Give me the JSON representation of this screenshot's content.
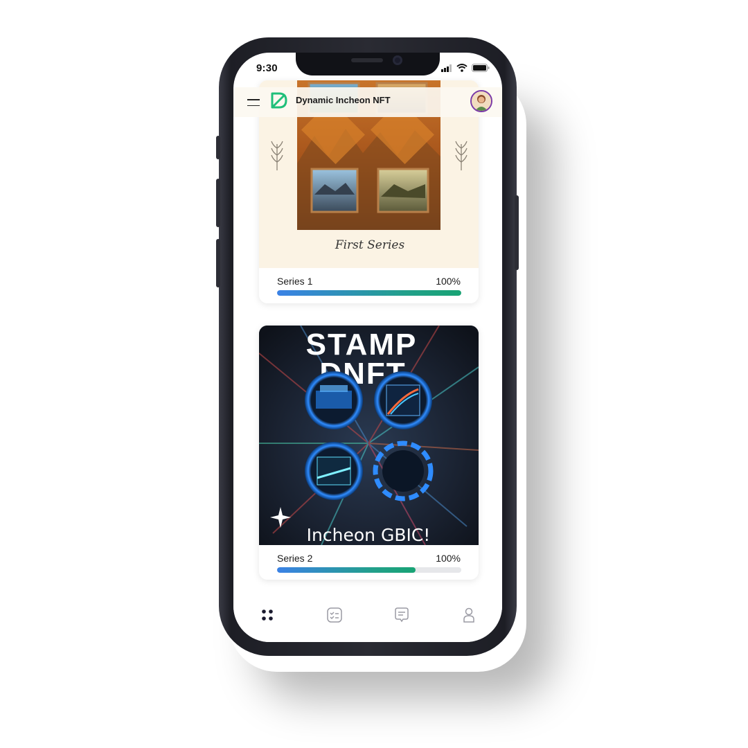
{
  "status_bar": {
    "time": "9:30"
  },
  "header": {
    "title": "Dynamic Incheon NFT"
  },
  "cards": [
    {
      "art_caption": "First Series",
      "label": "Series 1",
      "percent_text": "100%",
      "progress": 1.0
    },
    {
      "art_title_line1": "STAMP",
      "art_title_line2": "DNFT",
      "art_caption": "Incheon GBIC!",
      "label": "Series 2",
      "percent_text": "100%",
      "progress": 0.75
    }
  ],
  "tabbar": {
    "items": [
      "grid-icon",
      "checklist-icon",
      "chat-icon",
      "profile-icon"
    ],
    "active": 0
  },
  "colors": {
    "accent": "#1aa37a",
    "progress_start": "#3b82e6",
    "avatar_ring": "#7b3aa8"
  }
}
